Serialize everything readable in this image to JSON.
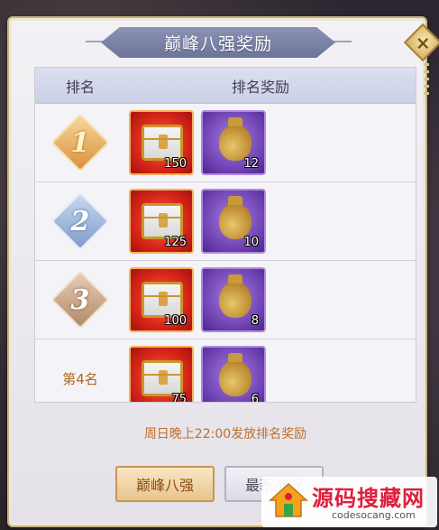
{
  "title": "巅峰八强奖励",
  "close_label": "×",
  "table": {
    "header_rank": "排名",
    "header_reward": "排名奖励",
    "rows": [
      {
        "rank": "1",
        "chest_count": "150",
        "bag_count": "12"
      },
      {
        "rank": "2",
        "chest_count": "125",
        "bag_count": "10"
      },
      {
        "rank": "3",
        "chest_count": "100",
        "bag_count": "8"
      },
      {
        "rank": "第4名",
        "chest_count": "75",
        "bag_count": "6"
      }
    ]
  },
  "footer_note": "周日晚上22:00发放排名奖励",
  "buttons": {
    "tab_top8": "巅峰八强",
    "tab_latest": "最新战况"
  },
  "watermark": {
    "title": "源码搜藏网",
    "url": "codesocang.com"
  },
  "colors": {
    "accent_gold": "#c79654",
    "note_orange": "#c0702a",
    "title_banner": "#6c7599"
  }
}
